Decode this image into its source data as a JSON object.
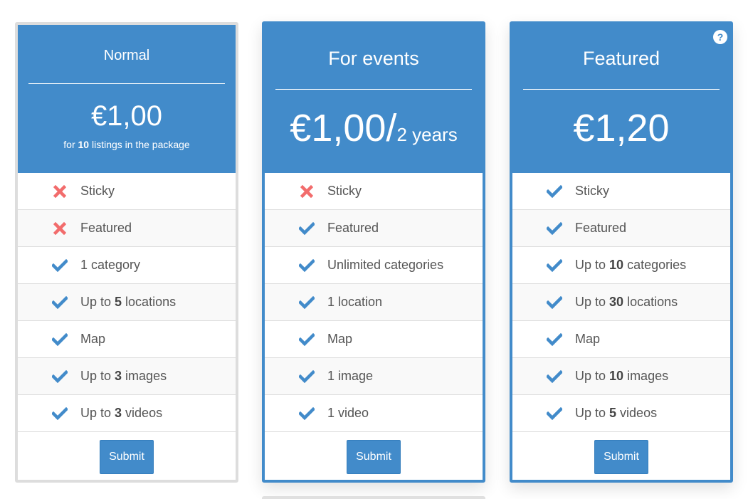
{
  "colors": {
    "accent": "#428bca",
    "cross": "#f26c6c",
    "check": "#428bca",
    "border_normal": "#dddddd"
  },
  "plans": [
    {
      "name": "Normal",
      "price": "€1,00",
      "note_prefix": "for ",
      "note_count": "10",
      "note_suffix": " listings in the package",
      "features": [
        {
          "icon": "cross-icon",
          "text": "Sticky"
        },
        {
          "icon": "cross-icon",
          "text": "Featured"
        },
        {
          "icon": "check-icon",
          "text": "1 category"
        },
        {
          "icon": "check-icon",
          "pre": "Up to ",
          "bold": "5",
          "post": " locations"
        },
        {
          "icon": "check-icon",
          "text": "Map"
        },
        {
          "icon": "check-icon",
          "pre": "Up to ",
          "bold": "3",
          "post": " images"
        },
        {
          "icon": "check-icon",
          "pre": "Up to ",
          "bold": "3",
          "post": " videos"
        }
      ],
      "submit_label": "Submit"
    },
    {
      "name": "For events",
      "price": "€1,00/",
      "price_unit": "2 years",
      "features": [
        {
          "icon": "cross-icon",
          "text": "Sticky"
        },
        {
          "icon": "check-icon",
          "text": "Featured"
        },
        {
          "icon": "check-icon",
          "text": "Unlimited categories"
        },
        {
          "icon": "check-icon",
          "text": "1 location"
        },
        {
          "icon": "check-icon",
          "text": "Map"
        },
        {
          "icon": "check-icon",
          "text": "1 image"
        },
        {
          "icon": "check-icon",
          "text": "1 video"
        }
      ],
      "submit_label": "Submit"
    },
    {
      "name": "Featured",
      "price": "€1,20",
      "help_icon": "question-circle-icon",
      "features": [
        {
          "icon": "check-icon",
          "text": "Sticky"
        },
        {
          "icon": "check-icon",
          "text": "Featured"
        },
        {
          "icon": "check-icon",
          "pre": "Up to ",
          "bold": "10",
          "post": " categories"
        },
        {
          "icon": "check-icon",
          "pre": "Up to ",
          "bold": "30",
          "post": " locations"
        },
        {
          "icon": "check-icon",
          "text": "Map"
        },
        {
          "icon": "check-icon",
          "pre": "Up to ",
          "bold": "10",
          "post": " images"
        },
        {
          "icon": "check-icon",
          "pre": "Up to ",
          "bold": "5",
          "post": " videos"
        }
      ],
      "submit_label": "Submit"
    }
  ]
}
